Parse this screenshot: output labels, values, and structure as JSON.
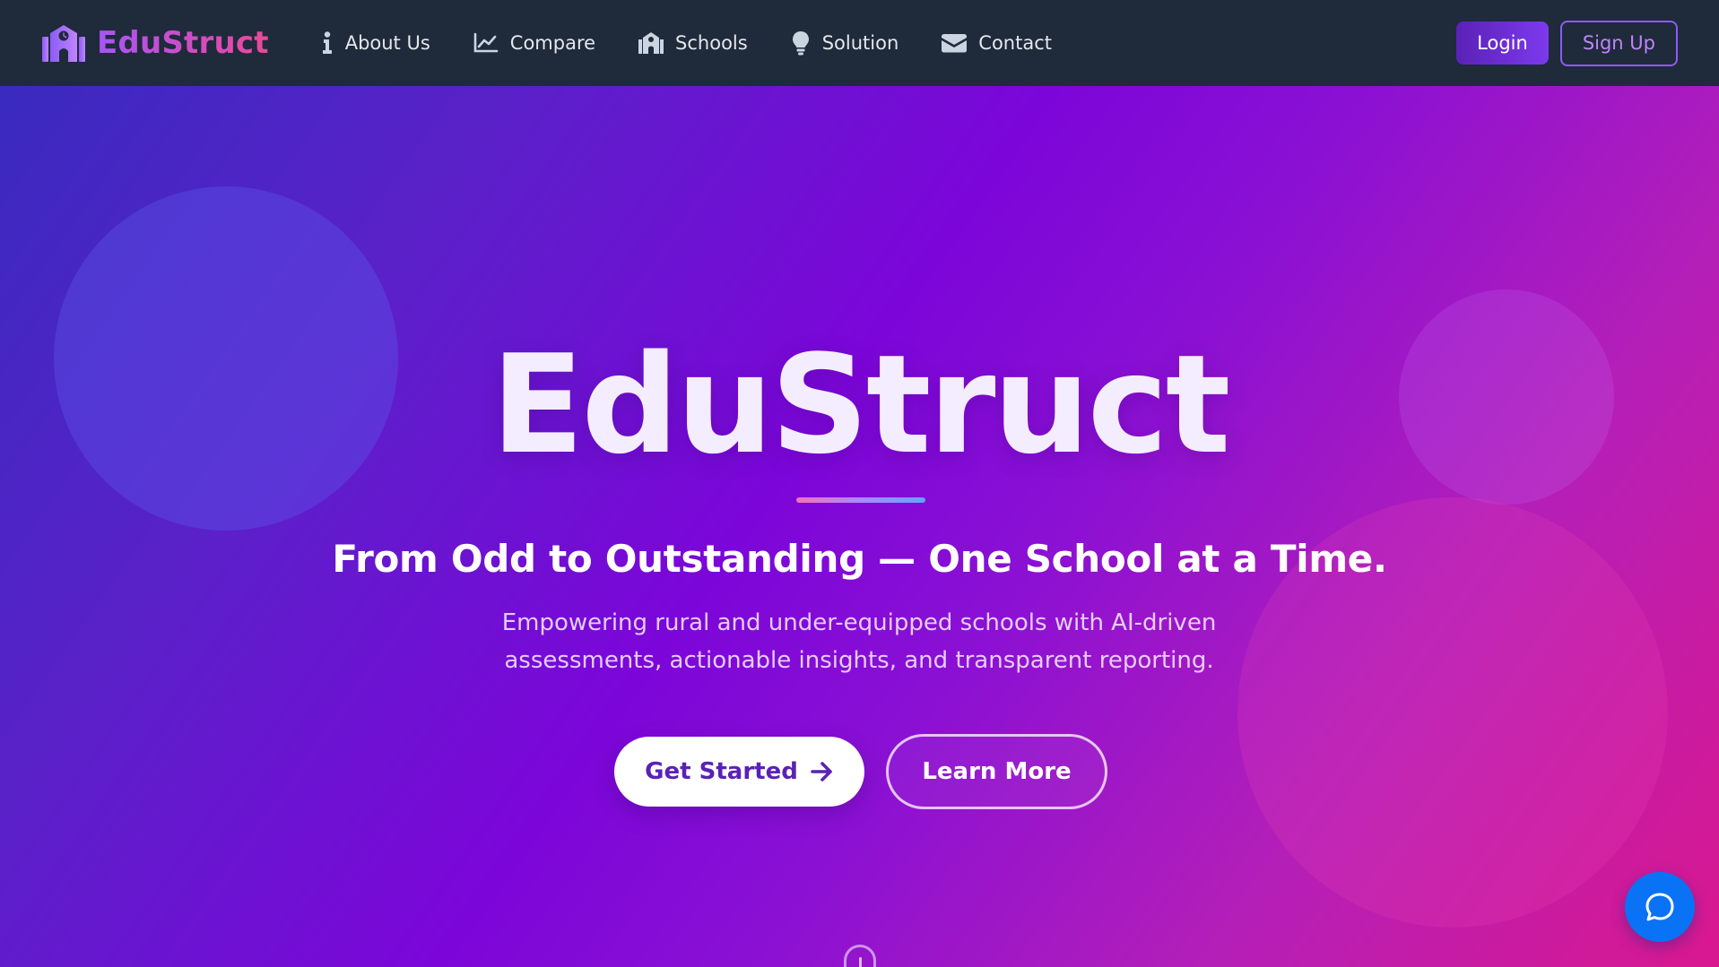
{
  "brand": {
    "name": "EduStruct",
    "icon": "school-building-icon"
  },
  "nav": {
    "links": [
      {
        "label": "About Us",
        "icon": "info-icon"
      },
      {
        "label": "Compare",
        "icon": "line-chart-icon"
      },
      {
        "label": "Schools",
        "icon": "school-icon"
      },
      {
        "label": "Solution",
        "icon": "lightbulb-icon"
      },
      {
        "label": "Contact",
        "icon": "envelope-icon"
      }
    ],
    "login_label": "Login",
    "signup_label": "Sign Up"
  },
  "hero": {
    "title": "EduStruct",
    "tagline": "From Odd to Outstanding — One School at a Time.",
    "description": "Empowering rural and under-equipped schools with AI-driven assessments, actionable insights, and transparent reporting.",
    "primary_cta": "Get Started",
    "primary_cta_icon": "arrow-right-icon",
    "secondary_cta": "Learn More"
  },
  "chat": {
    "icon": "chat-bubble-icon"
  },
  "colors": {
    "navbar_bg": "#1f2a3b",
    "brand_gradient_start": "#a855f7",
    "brand_gradient_end": "#ec4899",
    "login_bg": "#6d28d9",
    "signup_border": "#8b5cf6",
    "hero_gradient_start": "#3a2abf",
    "hero_gradient_mid": "#7c06d9",
    "hero_gradient_end": "#d9188f",
    "chat_button": "#0a72f5"
  }
}
